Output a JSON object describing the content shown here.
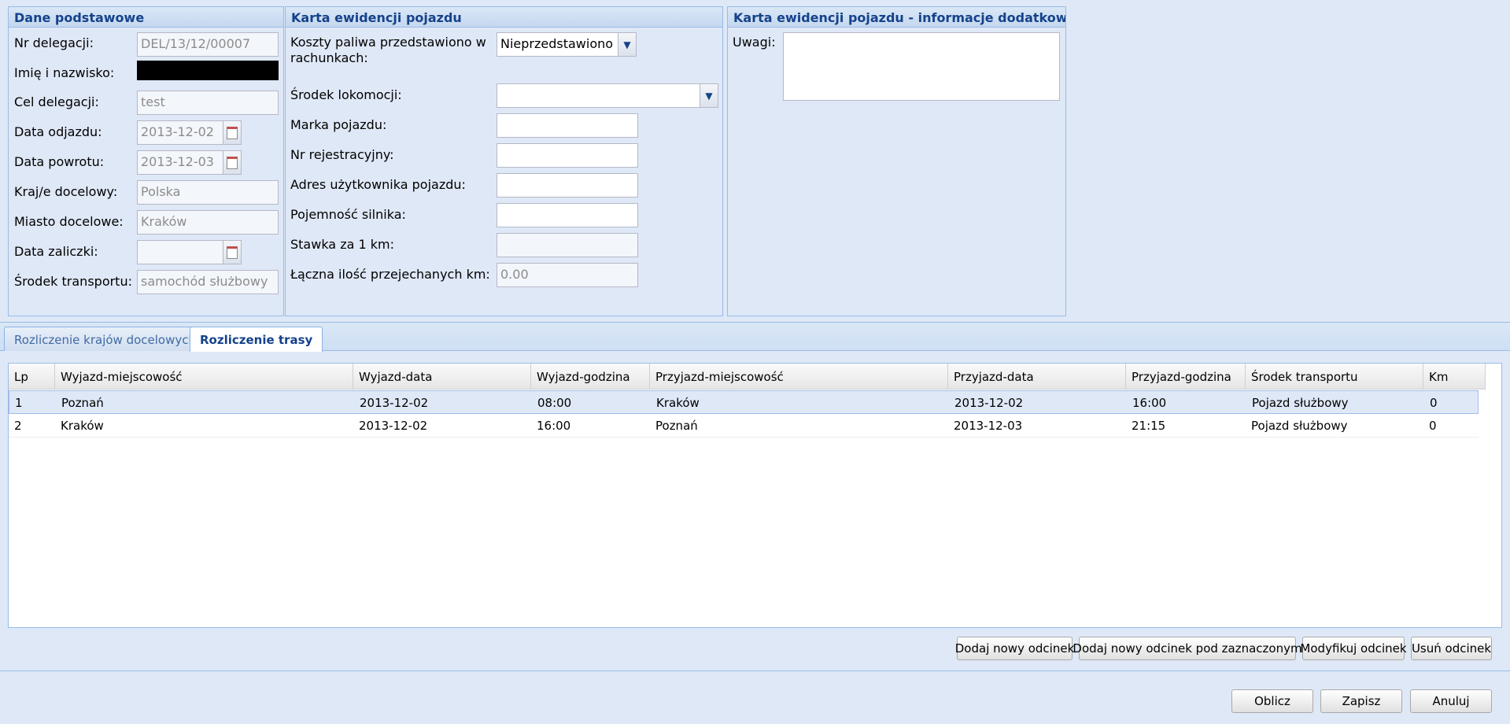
{
  "basic": {
    "title": "Dane podstawowe",
    "nr_delegacji": {
      "label": "Nr delegacji:",
      "value": "DEL/13/12/00007"
    },
    "imie": {
      "label": "Imię i nazwisko:",
      "value": ""
    },
    "cel": {
      "label": "Cel delegacji:",
      "value": "test"
    },
    "data_odjazdu": {
      "label": "Data odjazdu:",
      "value": "2013-12-02"
    },
    "data_powrotu": {
      "label": "Data powrotu:",
      "value": "2013-12-03"
    },
    "kraj": {
      "label": "Kraj/e docelowy:",
      "value": "Polska"
    },
    "miasto": {
      "label": "Miasto docelowe:",
      "value": "Kraków"
    },
    "data_zaliczki": {
      "label": "Data zaliczki:",
      "value": ""
    },
    "srodek_transportu": {
      "label": "Środek transportu:",
      "value": "samochód służbowy"
    }
  },
  "vehicle": {
    "title": "Karta ewidencji pojazdu",
    "koszty_label_1": "Koszty paliwa przedstawiono w",
    "koszty_label_2": "rachunkach:",
    "koszty_value": "Nieprzedstawiono",
    "srodek_lokomocji": {
      "label": "Środek lokomocji:",
      "value": ""
    },
    "marka": {
      "label": "Marka pojazdu:",
      "value": ""
    },
    "nr_rej": {
      "label": "Nr rejestracyjny:",
      "value": ""
    },
    "adres": {
      "label": "Adres użytkownika pojazdu:",
      "value": ""
    },
    "pojemnosc": {
      "label": "Pojemność silnika:",
      "value": ""
    },
    "stawka": {
      "label": "Stawka za 1 km:",
      "value": ""
    },
    "laczna": {
      "label": "Łączna ilość przejechanych km:",
      "value": "0.00"
    }
  },
  "extra": {
    "title": "Karta ewidencji pojazdu - informacje dodatkowe",
    "uwagi_label": "Uwagi:",
    "uwagi_value": ""
  },
  "tabs": [
    {
      "label": "Rozliczenie krajów docelowych"
    },
    {
      "label": "Rozliczenie trasy"
    }
  ],
  "grid": {
    "columns": [
      "Lp",
      "Wyjazd-miejscowość",
      "Wyjazd-data",
      "Wyjazd-godzina",
      "Przyjazd-miejscowość",
      "Przyjazd-data",
      "Przyjazd-godzina",
      "Środek transportu",
      "Km"
    ],
    "rows": [
      [
        "1",
        "Poznań",
        "2013-12-02",
        "08:00",
        "Kraków",
        "2013-12-02",
        "16:00",
        "Pojazd służbowy",
        "0"
      ],
      [
        "2",
        "Kraków",
        "2013-12-02",
        "16:00",
        "Poznań",
        "2013-12-03",
        "21:15",
        "Pojazd służbowy",
        "0"
      ]
    ]
  },
  "grid_buttons": {
    "dodaj": "Dodaj nowy odcinek",
    "dodaj_pod": "Dodaj nowy odcinek pod zaznaczonym",
    "modyfikuj": "Modyfikuj odcinek",
    "usun": "Usuń odcinek"
  },
  "footer_buttons": {
    "oblicz": "Oblicz",
    "zapisz": "Zapisz",
    "anuluj": "Anuluj"
  }
}
